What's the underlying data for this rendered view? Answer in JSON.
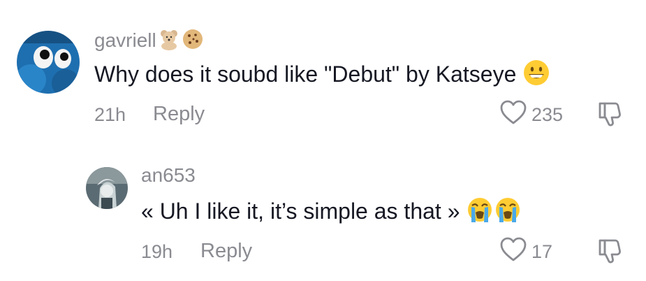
{
  "comments": [
    {
      "username": "gavriell",
      "username_emojis": [
        "teddy-bear",
        "cookie"
      ],
      "text": "Why does it soubd like \"Debut\" by Katseye",
      "text_emoji": "grinning-face",
      "time": "21h",
      "reply_label": "Reply",
      "likes": "235"
    },
    {
      "username": "an653",
      "text": "« Uh I like it, it’s simple as that »",
      "text_emojis": [
        "loudly-crying-face",
        "loudly-crying-face"
      ],
      "time": "19h",
      "reply_label": "Reply",
      "likes": "17"
    }
  ],
  "colors": {
    "primary_text": "#161823",
    "secondary_text": "#8a8b91"
  }
}
